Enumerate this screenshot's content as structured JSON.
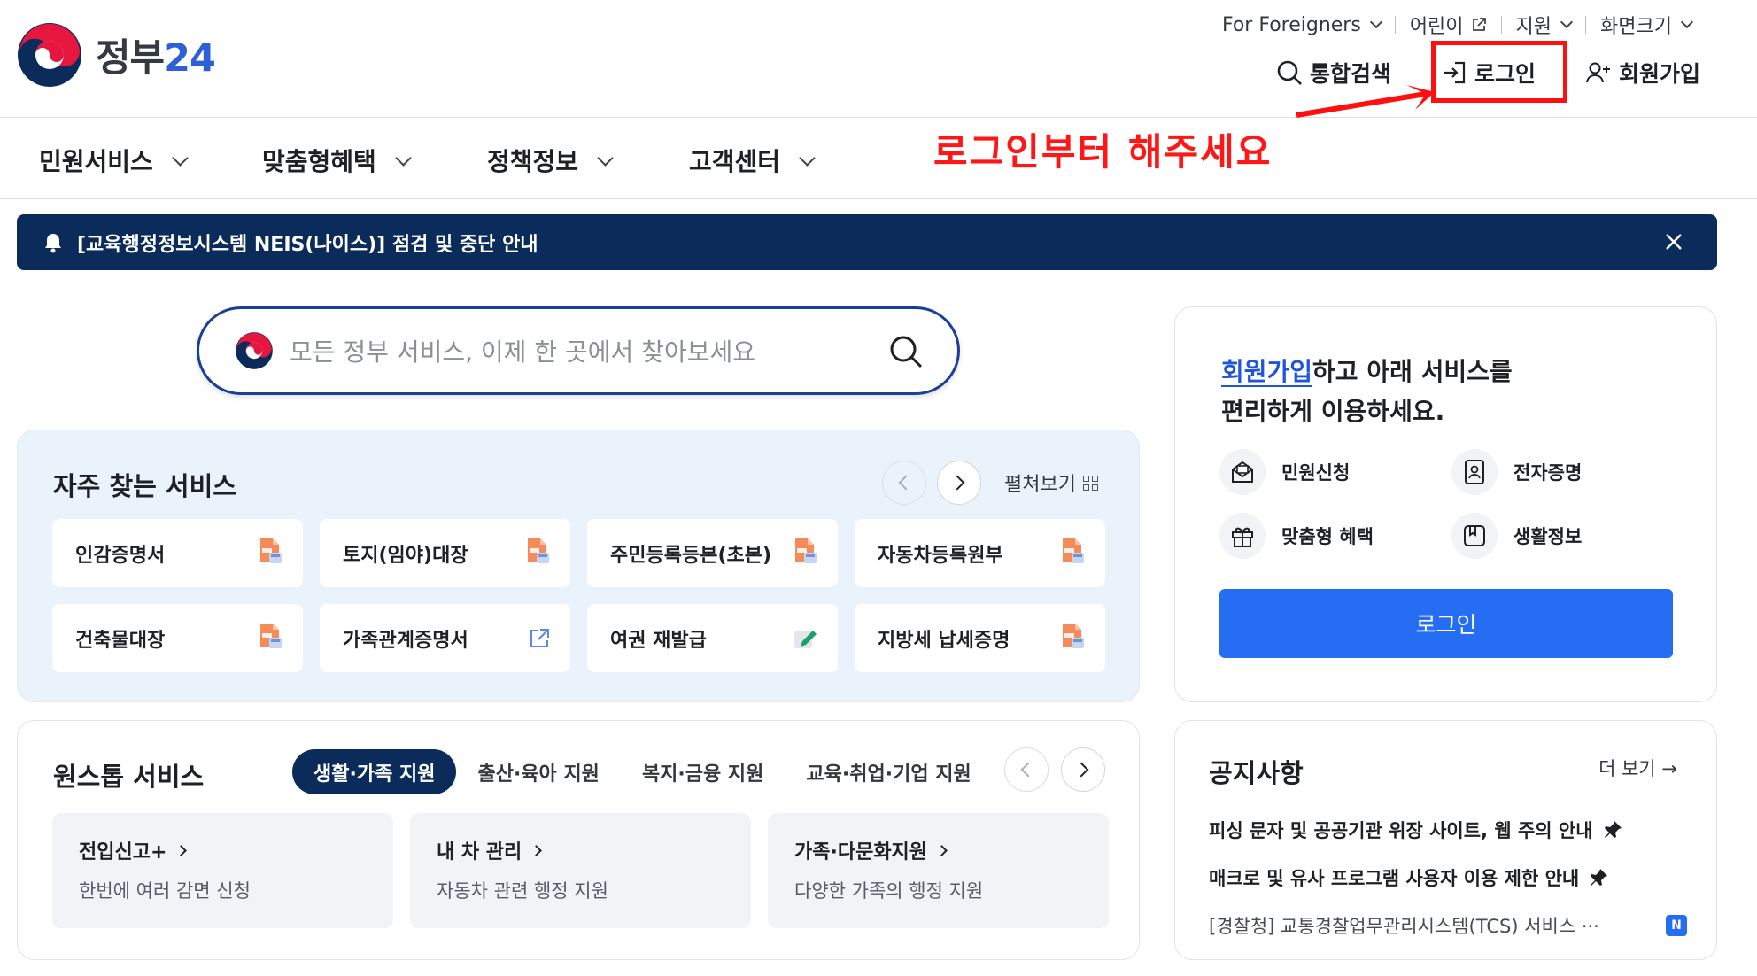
{
  "header": {
    "logo_text": "정부",
    "logo_num": "24",
    "util": {
      "foreigners": "For Foreigners",
      "kids": "어린이",
      "support": "지원",
      "screen_size": "화면크기"
    },
    "search_label": "통합검색",
    "login_label": "로그인",
    "signup_label": "회원가입"
  },
  "annotation": {
    "note": "로그인부터 해주세요",
    "color": "#ff1616"
  },
  "gnb": [
    "민원서비스",
    "맞춤형혜택",
    "정책정보",
    "고객센터"
  ],
  "banner": {
    "text": "[교육행정정보시스템 NEIS(나이스)] 점검 및 중단 안내"
  },
  "search": {
    "placeholder": "모든 정부 서비스, 이제 한 곳에서 찾아보세요"
  },
  "favorites": {
    "title": "자주 찾는 서비스",
    "expand_label": "펼쳐보기",
    "items": [
      {
        "label": "인감증명서",
        "icon": "pdf-doc-icon"
      },
      {
        "label": "토지(임야)대장",
        "icon": "pdf-doc-icon"
      },
      {
        "label": "주민등록등본(초본)",
        "icon": "pdf-doc-icon"
      },
      {
        "label": "자동차등록원부",
        "icon": "pdf-doc-icon"
      },
      {
        "label": "건축물대장",
        "icon": "pdf-doc-icon"
      },
      {
        "label": "가족관계증명서",
        "icon": "external-link-icon"
      },
      {
        "label": "여권 재발급",
        "icon": "edit-icon"
      },
      {
        "label": "지방세 납세증명",
        "icon": "pdf-doc-icon"
      }
    ]
  },
  "onestop": {
    "title": "원스톱 서비스",
    "tabs": [
      "생활·가족 지원",
      "출산·육아 지원",
      "복지·금융 지원",
      "교육·취업·기업 지원"
    ],
    "cards": [
      {
        "title": "전입신고+",
        "desc": "한번에 여러 감면 신청"
      },
      {
        "title": "내 차 관리",
        "desc": "자동차 관련 행정 지원"
      },
      {
        "title": "가족·다문화지원",
        "desc": "다양한 가족의 행정 지원"
      }
    ]
  },
  "login_card": {
    "signup_link": "회원가입",
    "line1_rest": "하고 아래 서비스를",
    "line2": "편리하게 이용하세요.",
    "services": [
      "민원신청",
      "전자증명",
      "맞춤형 혜택",
      "생활정보"
    ],
    "login_button": "로그인",
    "button_color": "#256ef4"
  },
  "notices": {
    "title": "공지사항",
    "more": "더 보기",
    "items": [
      "피싱 문자 및 공공기관 위장 사이트, 웹 주의 안내",
      "매크로 및 유사 프로그램 사용자 이용 제한 안내",
      "[경찰청] 교통경찰업무관리시스템(TCS) 서비스 ···"
    ],
    "new_badge": "N"
  }
}
